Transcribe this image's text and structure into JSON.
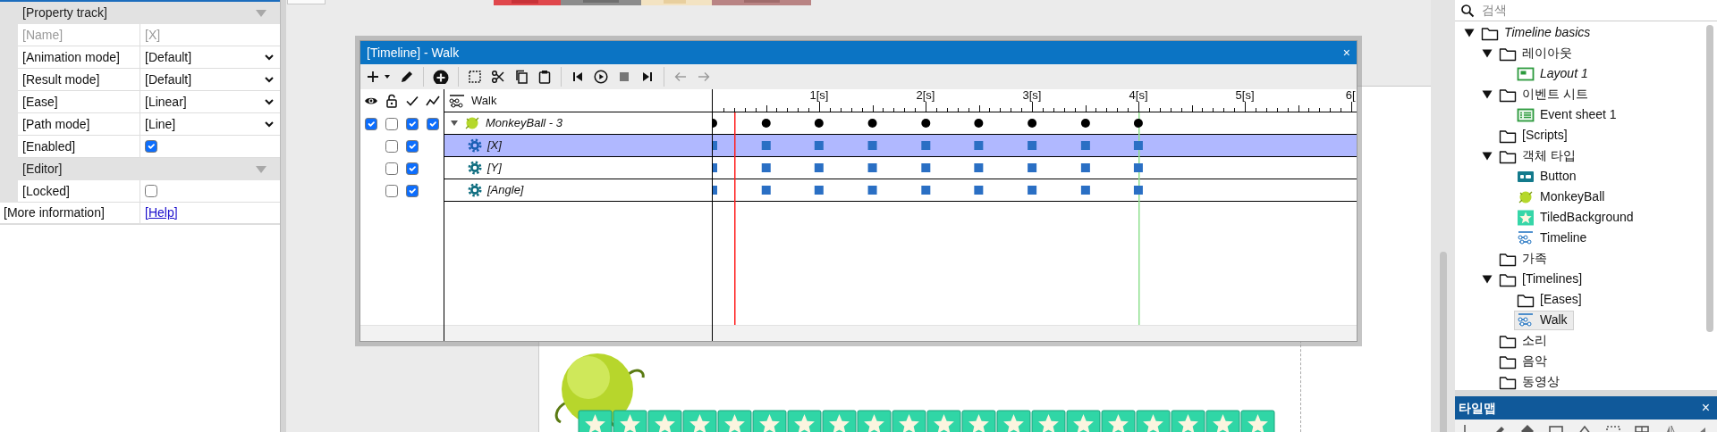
{
  "left_panel": {
    "groups": [
      {
        "title": "[Property track]",
        "expanded": true,
        "rows": [
          {
            "label": "[Name]",
            "kind": "readonly",
            "value": "[X]"
          },
          {
            "label": "[Animation mode]",
            "kind": "select",
            "value": "[Default]"
          },
          {
            "label": "[Result mode]",
            "kind": "select",
            "value": "[Default]"
          },
          {
            "label": "[Ease]",
            "kind": "select",
            "value": "[Linear]"
          },
          {
            "label": "[Path mode]",
            "kind": "select",
            "value": "[Line]"
          },
          {
            "label": "[Enabled]",
            "kind": "checkbox",
            "checked": true
          }
        ]
      },
      {
        "title": "[Editor]",
        "expanded": true,
        "rows": [
          {
            "label": "[Locked]",
            "kind": "checkbox",
            "checked": false
          }
        ]
      }
    ],
    "footer": {
      "label": "[More information]",
      "link": "[Help]"
    }
  },
  "timeline_window": {
    "title": "[Timeline] - Walk",
    "close": "×",
    "toolbar": [
      [
        {
          "kind": "add",
          "disabled": false
        },
        {
          "kind": "caret",
          "disabled": false
        },
        {
          "kind": "edit",
          "disabled": false
        }
      ],
      [
        {
          "kind": "add-circle",
          "disabled": false
        }
      ],
      [
        {
          "kind": "select",
          "disabled": false
        },
        {
          "kind": "cut",
          "disabled": false
        },
        {
          "kind": "copy",
          "disabled": false
        },
        {
          "kind": "paste",
          "disabled": false
        }
      ],
      [
        {
          "kind": "first",
          "disabled": false
        },
        {
          "kind": "play",
          "disabled": false
        },
        {
          "kind": "stop",
          "disabled": false
        },
        {
          "kind": "last",
          "disabled": false
        }
      ],
      [
        {
          "kind": "back",
          "disabled": true
        },
        {
          "kind": "forward",
          "disabled": true
        }
      ]
    ],
    "header": {
      "name": "Walk"
    },
    "ruler": {
      "labels": [
        "1[s]",
        "2[s]",
        "3[s]",
        "4[s]",
        "5[s]",
        "6["
      ]
    },
    "playhead": {
      "level": 0.033
    },
    "end_marker": {
      "level": 0.661
    },
    "tracks": [
      {
        "name": "MonkeyBall - 3",
        "kind": "object",
        "expanded": true,
        "selected": false,
        "visible": true,
        "locked": false,
        "enabled": true,
        "graph": true,
        "keyframes": [
          {
            "level": 0
          },
          {
            "level": 0.083
          },
          {
            "level": 0.165
          },
          {
            "level": 0.248
          },
          {
            "level": 0.331
          },
          {
            "level": 0.413
          },
          {
            "level": 0.496
          },
          {
            "level": 0.579
          },
          {
            "level": 0.661
          }
        ],
        "children": [
          {
            "name": "[X]",
            "kind": "property",
            "selected": true,
            "locked": false,
            "enabled": true,
            "keyframes": [
              {
                "level": 0
              },
              {
                "level": 0.083
              },
              {
                "level": 0.165
              },
              {
                "level": 0.248
              },
              {
                "level": 0.331
              },
              {
                "level": 0.413
              },
              {
                "level": 0.496
              },
              {
                "level": 0.579
              },
              {
                "level": 0.661
              }
            ]
          },
          {
            "name": "[Y]",
            "kind": "property",
            "selected": false,
            "locked": false,
            "enabled": true,
            "keyframes": [
              {
                "level": 0
              },
              {
                "level": 0.083
              },
              {
                "level": 0.165
              },
              {
                "level": 0.248
              },
              {
                "level": 0.331
              },
              {
                "level": 0.413
              },
              {
                "level": 0.496
              },
              {
                "level": 0.579
              },
              {
                "level": 0.661
              }
            ]
          },
          {
            "name": "[Angle]",
            "kind": "property",
            "selected": false,
            "locked": false,
            "enabled": true,
            "keyframes": [
              {
                "level": 0
              },
              {
                "level": 0.083
              },
              {
                "level": 0.165
              },
              {
                "level": 0.248
              },
              {
                "level": 0.331
              },
              {
                "level": 0.413
              },
              {
                "level": 0.496
              },
              {
                "level": 0.579
              },
              {
                "level": 0.661
              }
            ]
          }
        ]
      }
    ]
  },
  "project_panel": {
    "search": {
      "placeholder": "검색"
    },
    "tree": [
      {
        "label": "Timeline basics",
        "kind": "folder",
        "italic": true,
        "expanded": true,
        "selected": false,
        "children": [
          {
            "label": "레이아웃",
            "kind": "folder",
            "italic": false,
            "expanded": true,
            "selected": false,
            "children": [
              {
                "label": "Layout 1",
                "kind": "layout",
                "italic": true,
                "selected": false
              }
            ]
          },
          {
            "label": "이벤트 시트",
            "kind": "folder",
            "italic": false,
            "expanded": true,
            "selected": false,
            "children": [
              {
                "label": "Event sheet 1",
                "kind": "eventsheet",
                "italic": false,
                "selected": false
              }
            ]
          },
          {
            "label": "[Scripts]",
            "kind": "folder",
            "italic": false,
            "selected": false
          },
          {
            "label": "객체 타입",
            "kind": "folder",
            "italic": false,
            "expanded": true,
            "selected": false,
            "children": [
              {
                "label": "Button",
                "kind": "button",
                "italic": false,
                "selected": false
              },
              {
                "label": "MonkeyBall",
                "kind": "sprite",
                "italic": false,
                "selected": false
              },
              {
                "label": "TiledBackground",
                "kind": "tiled",
                "italic": false,
                "selected": false
              },
              {
                "label": "Timeline",
                "kind": "timeline",
                "italic": false,
                "selected": false
              }
            ]
          },
          {
            "label": "가족",
            "kind": "folder",
            "italic": false,
            "selected": false
          },
          {
            "label": "[Timelines]",
            "kind": "folder",
            "italic": false,
            "expanded": true,
            "selected": false,
            "children": [
              {
                "label": "[Eases]",
                "kind": "folder",
                "italic": false,
                "selected": false
              },
              {
                "label": "Walk",
                "kind": "timeline",
                "italic": false,
                "selected": true
              }
            ]
          },
          {
            "label": "소리",
            "kind": "folder",
            "italic": false,
            "selected": false
          },
          {
            "label": "음악",
            "kind": "folder",
            "italic": false,
            "selected": false
          },
          {
            "label": "동영상",
            "kind": "folder",
            "italic": false,
            "selected": false
          }
        ]
      }
    ]
  },
  "tilemap_panel": {
    "title": "타일맵",
    "close": "×"
  }
}
